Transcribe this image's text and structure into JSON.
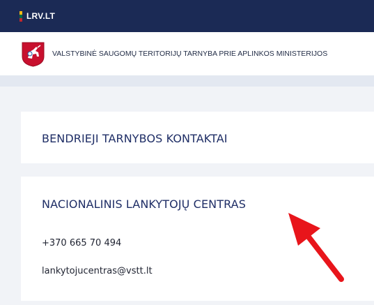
{
  "topbar": {
    "site_label": "LRV.LT",
    "flag_colors": [
      "#fdb913",
      "#006a44",
      "#c1272d"
    ]
  },
  "institution": {
    "name": "VALSTYBINĖ SAUGOMŲ TERITORIJŲ TARNYBA PRIE APLINKOS MINISTERIJOS",
    "coat_of_arms_icon": "vytis-coat-of-arms-icon"
  },
  "sections": {
    "general": {
      "title": "BENDRIEJI TARNYBOS KONTAKTAI"
    },
    "visitor_center": {
      "title": "NACIONALINIS LANKYTOJŲ CENTRAS",
      "phone": "+370 665 70 494",
      "email": "lankytojucentras@vstt.lt"
    }
  },
  "annotation": {
    "arrow_color": "#e8151b",
    "arrow_icon": "red-arrow-icon"
  }
}
